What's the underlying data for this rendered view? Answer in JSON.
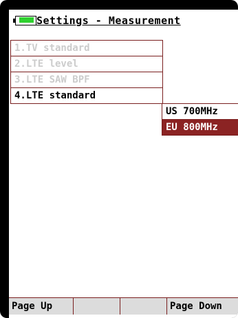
{
  "title": "Settings - Measurement",
  "battery": {
    "icon": "battery-icon",
    "level": 0.7,
    "color": "#2fd12f"
  },
  "menu": {
    "items": [
      {
        "label": "1.TV standard"
      },
      {
        "label": "2.LTE level"
      },
      {
        "label": "3.LTE SAW BPF"
      },
      {
        "label": "4.LTE standard"
      }
    ]
  },
  "options": {
    "items": [
      {
        "label": "US 700MHz"
      },
      {
        "label": "EU 800MHz"
      }
    ],
    "selected": "EU 800MHz"
  },
  "softkeys": [
    {
      "label": "Page Up"
    },
    {
      "label": ""
    },
    {
      "label": ""
    },
    {
      "label": "Page Down"
    }
  ],
  "colors": {
    "accent": "#8b2323",
    "border": "#7a1f1f",
    "inactive_text": "#cccccc"
  }
}
